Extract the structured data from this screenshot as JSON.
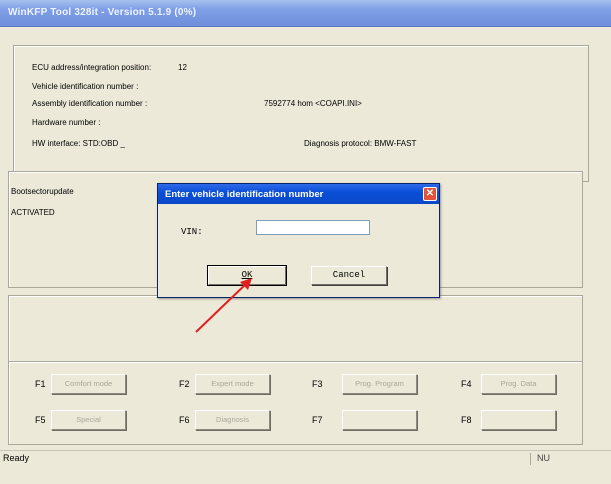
{
  "window": {
    "title": "WinKFP Tool 328it - Version 5.1.9 (0%)"
  },
  "info": {
    "ecu_address_label": "ECU address/integration position:",
    "ecu_address_value": "12",
    "vin_label": "Vehicle identification number :",
    "assembly_label": "Assembly identification number :",
    "assembly_value": "7592774  hom  <COAPI.INI>",
    "hardware_label": "Hardware number :",
    "hw_interface": "HW interface:  STD:OBD _",
    "diag_protocol": "Diagnosis protocol:  BMW-FAST"
  },
  "boot": {
    "title": "Bootsectorupdate",
    "status": "ACTIVATED"
  },
  "fkeys": [
    {
      "key": "F1",
      "label": "Comfort mode"
    },
    {
      "key": "F2",
      "label": "Expert mode"
    },
    {
      "key": "F3",
      "label": "Prog. Program"
    },
    {
      "key": "F4",
      "label": "Prog. Data"
    },
    {
      "key": "F5",
      "label": "Special"
    },
    {
      "key": "F6",
      "label": "Diagnosis"
    },
    {
      "key": "F7",
      "label": ""
    },
    {
      "key": "F8",
      "label": ""
    }
  ],
  "status": {
    "text": "Ready",
    "right": "NU"
  },
  "dialog": {
    "title": "Enter vehicle identification number",
    "close_glyph": "✕",
    "vin_label": "VIN:",
    "vin_value": "",
    "ok_label": "OK",
    "cancel_label": "Cancel"
  },
  "colors": {
    "arrow": "#e02020"
  }
}
